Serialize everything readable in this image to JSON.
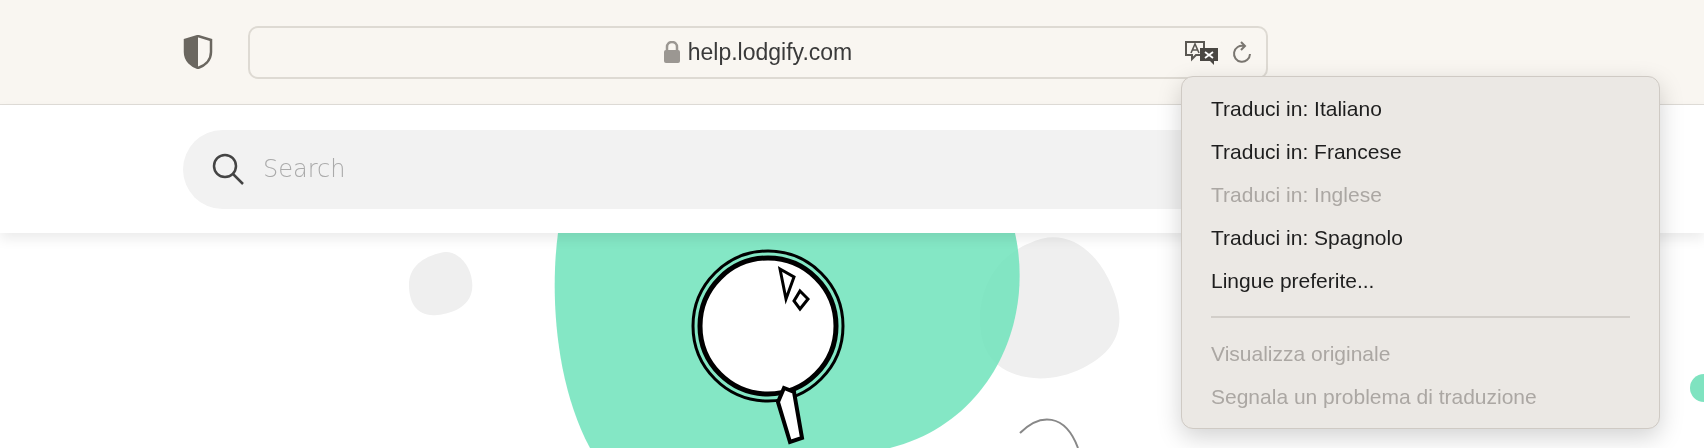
{
  "toolbar": {
    "address": "help.lodgify.com"
  },
  "page": {
    "search": {
      "placeholder": "Search"
    }
  },
  "translate_menu": {
    "items": [
      {
        "kind": "item",
        "label": "Traduci in: Italiano",
        "disabled": false
      },
      {
        "kind": "item",
        "label": "Traduci in: Francese",
        "disabled": false
      },
      {
        "kind": "item",
        "label": "Traduci in: Inglese",
        "disabled": true
      },
      {
        "kind": "item",
        "label": "Traduci in: Spagnolo",
        "disabled": false
      },
      {
        "kind": "item",
        "label": "Lingue preferite...",
        "disabled": false
      },
      {
        "kind": "separator"
      },
      {
        "kind": "item",
        "label": "Visualizza originale",
        "disabled": true
      },
      {
        "kind": "item",
        "label": "Segnala un problema di traduzione",
        "disabled": true
      }
    ]
  }
}
